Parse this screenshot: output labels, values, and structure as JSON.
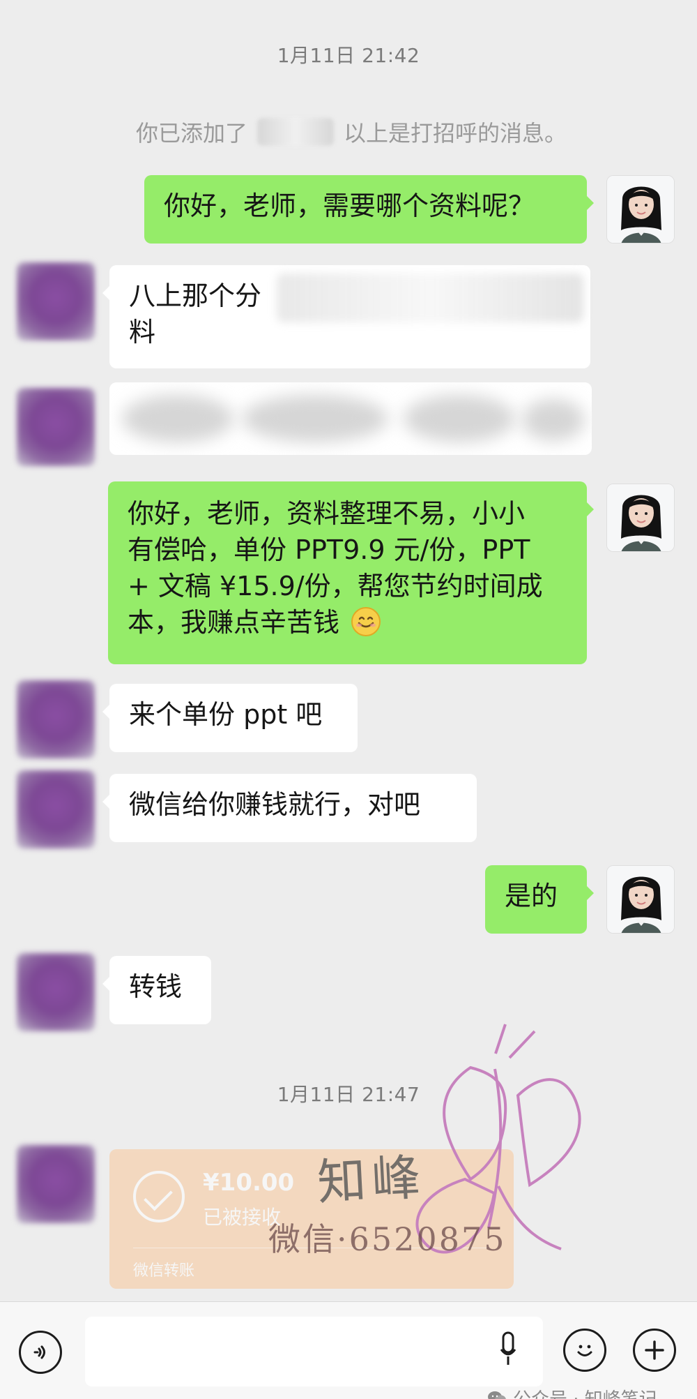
{
  "timestamps": {
    "first": "1月11日 21:42",
    "second": "1月11日 21:47"
  },
  "system": {
    "prefix": "你已添加了",
    "suffix": "以上是打招呼的消息。"
  },
  "messages": {
    "m1": "你好，老师，需要哪个资料呢？",
    "m2_line1": "八上那个分",
    "m2_line2": "料",
    "m4_line1": "你好，老师，资料整理不易，小小",
    "m4_line2": "有偿哈，单份 PPT9.9 元/份，PPT",
    "m4_line3": "+ 文稿 ¥15.9/份，帮您节约时间成",
    "m4_line4": "本，我赚点辛苦钱",
    "m5": "来个单份 ppt 吧",
    "m6": "微信给你赚钱就行，对吧",
    "m7": "是的",
    "m8": "转钱"
  },
  "transfer": {
    "amount": "¥10.00",
    "status": "已被接收",
    "footer": "微信转账"
  },
  "watermark": {
    "brand": "知峰",
    "contact": "微信·6520875",
    "platform": "公众号 · 知峰笔记"
  },
  "icons": {
    "voice": "voice-icon",
    "emoji": "emoji-icon",
    "plus": "plus-icon",
    "mic": "mic-icon",
    "smile": "smile-emoji-icon"
  }
}
